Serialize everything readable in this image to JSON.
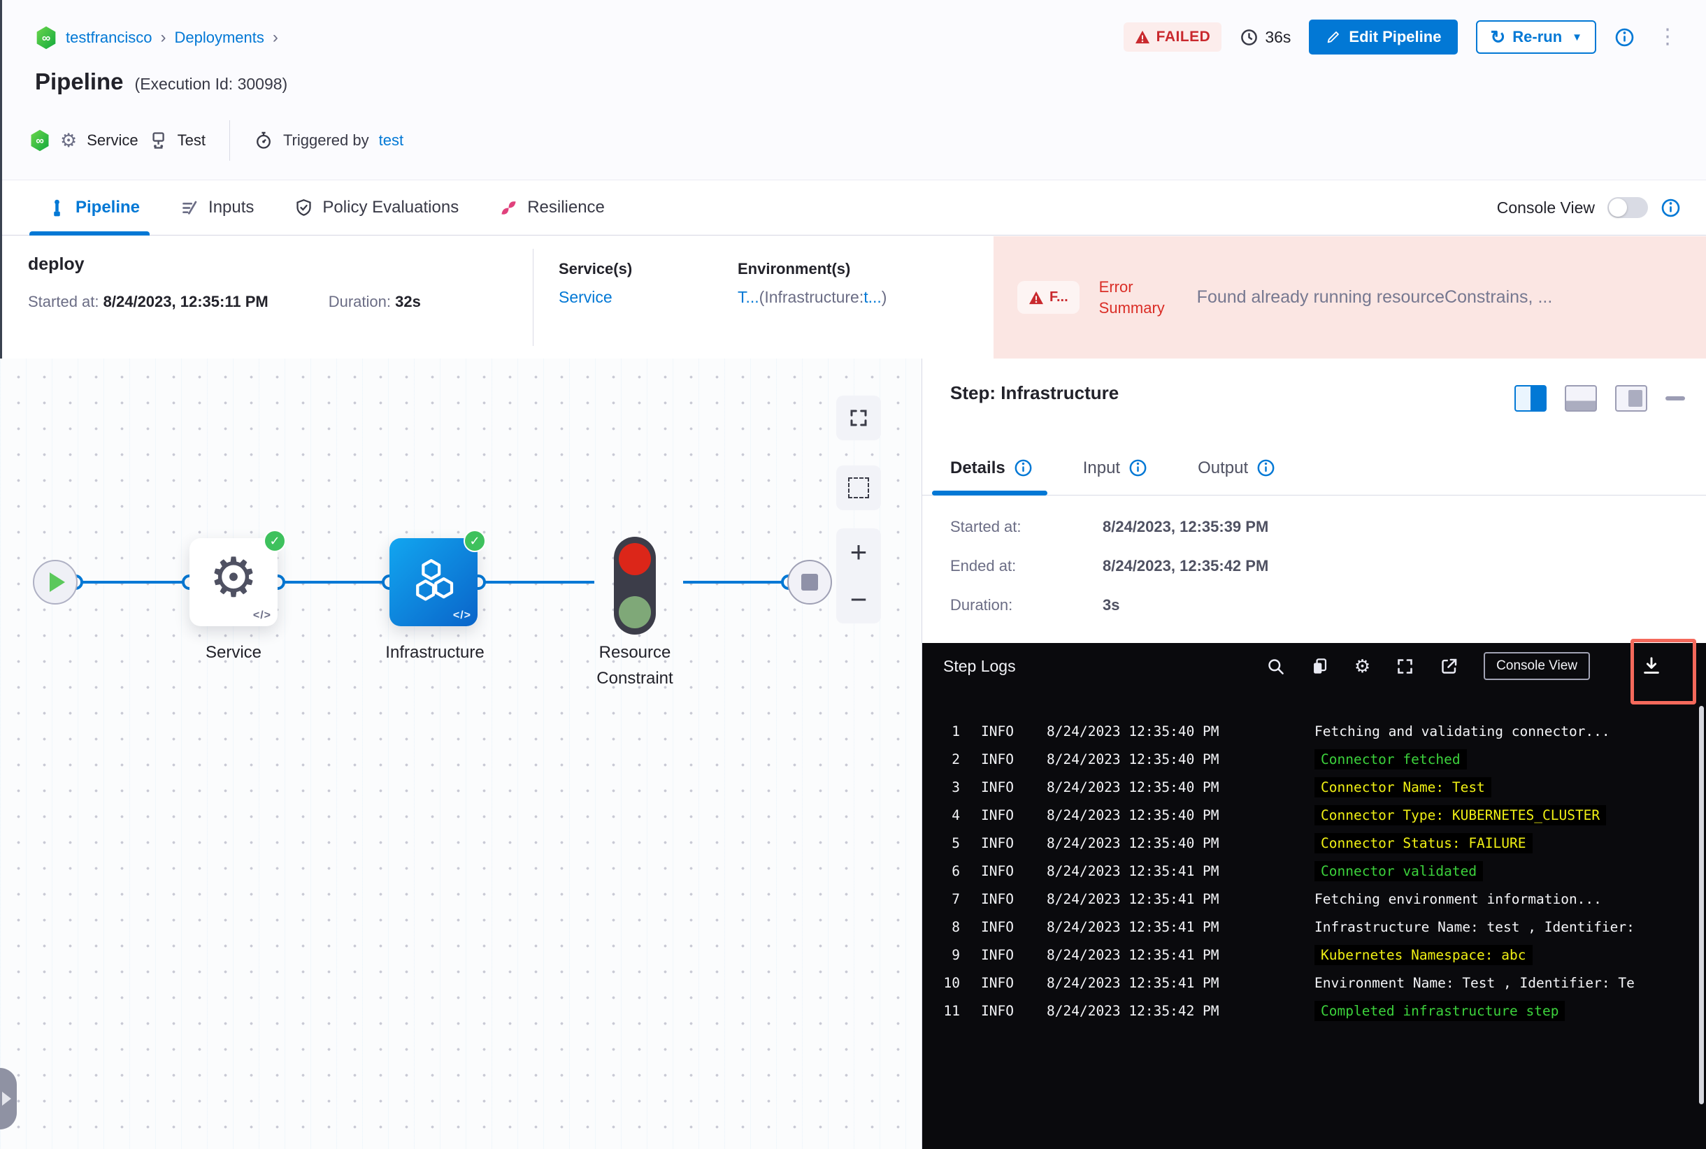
{
  "colors": {
    "accent": "#0278D5",
    "failed_red": "#C9292E",
    "success_green": "#3EC15D",
    "error_bg": "#FBE6E3",
    "log_green": "#3CD23C",
    "log_yellow": "#F0F014",
    "highlight_red": "#F4695B"
  },
  "header": {
    "breadcrumb_project": "testfrancisco",
    "breadcrumb_section": "Deployments",
    "title": "Pipeline",
    "execution_id": "(Execution Id: 30098)",
    "status_badge": "FAILED",
    "elapsed": "36s",
    "edit_pipeline_label": "Edit Pipeline",
    "rerun_label": "Re-run",
    "meta_service": "Service",
    "meta_test": "Test",
    "triggered_by_label": "Triggered by",
    "triggered_by_value": "test"
  },
  "tabs": {
    "pipeline": "Pipeline",
    "inputs": "Inputs",
    "policy_evaluations": "Policy Evaluations",
    "resilience": "Resilience",
    "console_view_label": "Console View"
  },
  "stage": {
    "name": "deploy",
    "started_label": "Started at:",
    "started_value": "8/24/2023, 12:35:11 PM",
    "duration_label": "Duration:",
    "duration_value": "32s",
    "services_label": "Service(s)",
    "services_value": "Service",
    "environments_label": "Environment(s)",
    "env_link_1": "T...",
    "env_infix": "(Infrastructure:",
    "env_link_2": "t...",
    "env_suffix": ")",
    "error_chip": "F...",
    "error_label": "Error Summary",
    "error_message": "Found already running resourceConstrains, ..."
  },
  "graph": {
    "node_service": "Service",
    "node_infrastructure": "Infrastructure",
    "node_resource_constraint": "Resource Constraint",
    "code_chip": "</>"
  },
  "step_panel": {
    "title": "Step: Infrastructure",
    "tab_details": "Details",
    "tab_input": "Input",
    "tab_output": "Output",
    "details": {
      "started_label": "Started at:",
      "started_value": "8/24/2023, 12:35:39 PM",
      "ended_label": "Ended at:",
      "ended_value": "8/24/2023, 12:35:42 PM",
      "duration_label": "Duration:",
      "duration_value": "3s"
    }
  },
  "step_logs": {
    "title": "Step Logs",
    "console_view_label": "Console View",
    "lines": [
      {
        "num": "1",
        "level": "INFO",
        "time": "8/24/2023 12:35:40 PM",
        "text": "Fetching and validating connector...",
        "color": "white"
      },
      {
        "num": "2",
        "level": "INFO",
        "time": "8/24/2023 12:35:40 PM",
        "text": "Connector fetched",
        "color": "green"
      },
      {
        "num": "3",
        "level": "INFO",
        "time": "8/24/2023 12:35:40 PM",
        "text": "Connector Name: Test",
        "color": "yellow"
      },
      {
        "num": "4",
        "level": "INFO",
        "time": "8/24/2023 12:35:40 PM",
        "text": "Connector Type: KUBERNETES_CLUSTER",
        "color": "yellow"
      },
      {
        "num": "5",
        "level": "INFO",
        "time": "8/24/2023 12:35:40 PM",
        "text": "Connector Status: FAILURE",
        "color": "yellow"
      },
      {
        "num": "6",
        "level": "INFO",
        "time": "8/24/2023 12:35:41 PM",
        "text": "Connector validated",
        "color": "green"
      },
      {
        "num": "7",
        "level": "INFO",
        "time": "8/24/2023 12:35:41 PM",
        "text": "Fetching environment information...",
        "color": "white"
      },
      {
        "num": "8",
        "level": "INFO",
        "time": "8/24/2023 12:35:41 PM",
        "text": "Infrastructure Name: test , Identifier:",
        "color": "white"
      },
      {
        "num": "9",
        "level": "INFO",
        "time": "8/24/2023 12:35:41 PM",
        "text": "Kubernetes Namespace: abc",
        "color": "yellow"
      },
      {
        "num": "10",
        "level": "INFO",
        "time": "8/24/2023 12:35:41 PM",
        "text": "Environment Name: Test , Identifier: Te",
        "color": "white"
      },
      {
        "num": "11",
        "level": "INFO",
        "time": "8/24/2023 12:35:42 PM",
        "text": "Completed infrastructure step",
        "color": "green"
      }
    ]
  }
}
